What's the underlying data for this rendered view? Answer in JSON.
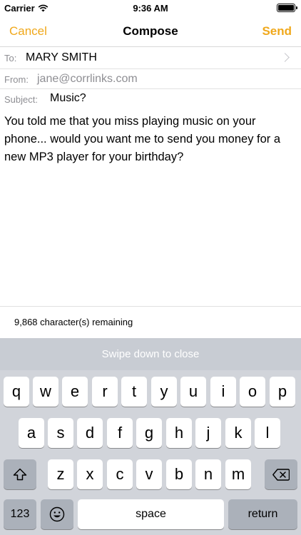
{
  "status_bar": {
    "carrier": "Carrier",
    "time": "9:36 AM"
  },
  "nav": {
    "cancel": "Cancel",
    "title": "Compose",
    "send": "Send"
  },
  "fields": {
    "to_label": "To:",
    "to_value": "MARY SMITH",
    "from_label": "From:",
    "from_value": "jane@corrlinks.com",
    "subject_label": "Subject:",
    "subject_value": "Music?"
  },
  "message_body": "You told me that you miss playing music on your phone... would you want me to send you money for a new MP3 player for your birthday?",
  "remaining": "9,868 character(s) remaining",
  "keyboard": {
    "hint": "Swipe down to close",
    "row1": [
      "q",
      "w",
      "e",
      "r",
      "t",
      "y",
      "u",
      "i",
      "o",
      "p"
    ],
    "row2": [
      "a",
      "s",
      "d",
      "f",
      "g",
      "h",
      "j",
      "k",
      "l"
    ],
    "row3": [
      "z",
      "x",
      "c",
      "v",
      "b",
      "n",
      "m"
    ],
    "numbers": "123",
    "space": "space",
    "return": "return"
  },
  "colors": {
    "accent": "#f0a81b",
    "keyboard_bg": "#d1d4da"
  }
}
